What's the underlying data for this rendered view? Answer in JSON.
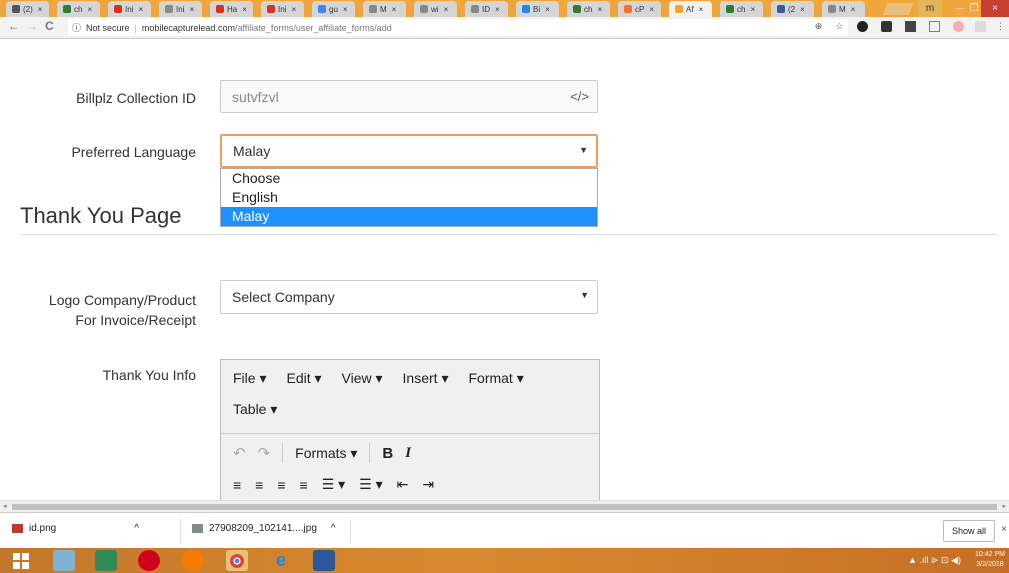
{
  "browser": {
    "tabs": [
      {
        "label": "(2)",
        "color": "#555"
      },
      {
        "label": "ch",
        "color": "#2e7d32"
      },
      {
        "label": "Ini",
        "color": "#d93025"
      },
      {
        "label": "Ini",
        "color": "#888"
      },
      {
        "label": "Ha",
        "color": "#d93025"
      },
      {
        "label": "Ini",
        "color": "#d93025"
      },
      {
        "label": "gu",
        "color": "#4285f4"
      },
      {
        "label": "M",
        "color": "#888"
      },
      {
        "label": "wi",
        "color": "#888"
      },
      {
        "label": "ID",
        "color": "#888"
      },
      {
        "label": "Bi",
        "color": "#1e88e5"
      },
      {
        "label": "ch",
        "color": "#2e7d32"
      },
      {
        "label": "cP",
        "color": "#ff6c2c"
      },
      {
        "label": "Af",
        "color": "#f5a623",
        "active": true
      },
      {
        "label": "ch",
        "color": "#2e7d32"
      },
      {
        "label": "(2",
        "color": "#3b5998"
      },
      {
        "label": "M",
        "color": "#888"
      }
    ],
    "tab_close": "×",
    "window_user": "m",
    "minimize": "–",
    "maximize": "❐",
    "close": "×",
    "back": "←",
    "forward": "→",
    "reload": "C",
    "security_label": "Not secure",
    "url_host": "mobilecapturelead.com",
    "url_path": "/affiliate_forms/user_affiliate_forms/add",
    "info_icon": "ⓘ",
    "zoom_icon": "⊕",
    "star_icon": "☆",
    "menu_icon": "⋮"
  },
  "form": {
    "billplz_label": "Billplz Collection ID",
    "billplz_value": "sutvfzvl",
    "billplz_icon": "</>",
    "language_label": "Preferred Language",
    "language_value": "Malay",
    "language_options": [
      "Choose",
      "English",
      "Malay"
    ],
    "language_selected_index": 2,
    "section_title": "Thank You Page",
    "logo_label_line1": "Logo Company/Product",
    "logo_label_line2": "For Invoice/Receipt",
    "logo_value": "Select Company",
    "thankyou_label": "Thank You Info",
    "select_caret": "▼"
  },
  "editor": {
    "menu": [
      "File ▾",
      "Edit ▾",
      "View ▾",
      "Insert ▾",
      "Format ▾"
    ],
    "menu2": "Table ▾",
    "undo": "↶",
    "redo": "↷",
    "formats": "Formats ▾",
    "bold": "B",
    "italic": "I",
    "align_icons": [
      "≡",
      "≡",
      "≡",
      "≡"
    ],
    "list_icons": [
      "☰ ▾",
      "☰ ▾",
      "⇤",
      "⇥"
    ]
  },
  "scrollbar": {
    "left_arrow": "◂",
    "right_arrow": "▸"
  },
  "downloads": {
    "items": [
      {
        "name": "id.png",
        "chevron": "^"
      },
      {
        "name": "27908209_102141....jpg",
        "chevron": "^"
      }
    ],
    "show_all": "Show all",
    "close": "×"
  },
  "taskbar": {
    "clock_time": "10:42 PM",
    "clock_date": "3/2/2018",
    "tray": "▲ .ıll ⊳ ⊡ ◀)"
  }
}
